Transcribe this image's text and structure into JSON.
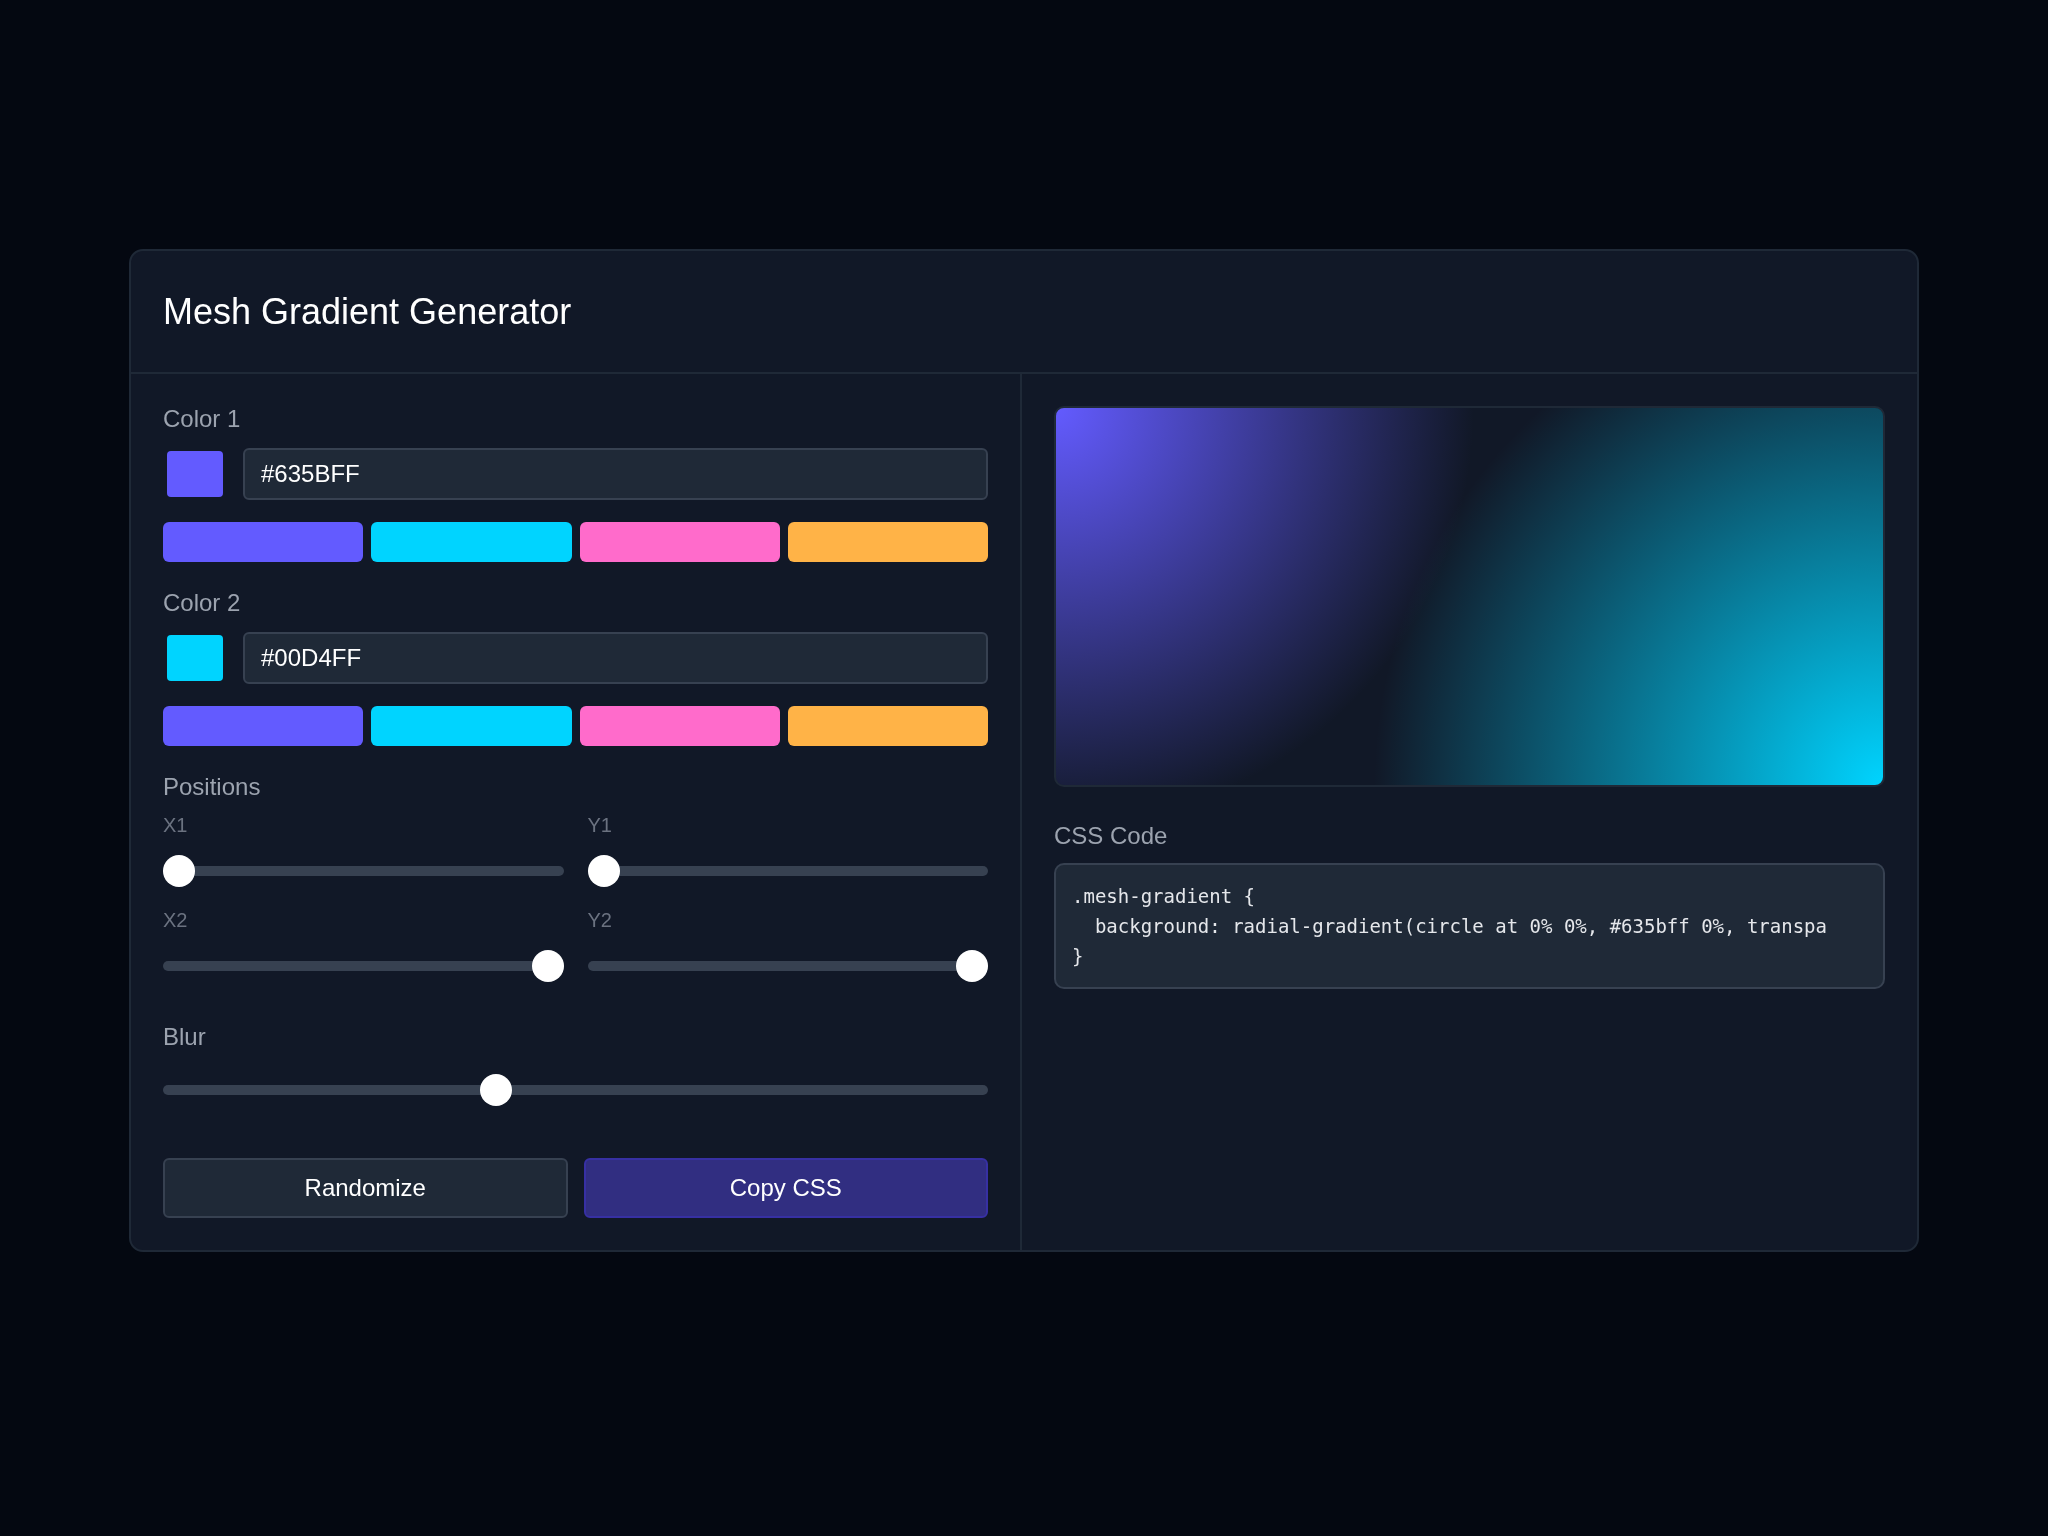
{
  "title": "Mesh Gradient Generator",
  "colors": [
    {
      "label": "Color 1",
      "color": "#635bff",
      "value": "#635BFF",
      "presets": [
        {
          "color": "#635bff"
        },
        {
          "color": "#00d4ff"
        },
        {
          "color": "#ff6bcb"
        },
        {
          "color": "#ffb347"
        }
      ]
    },
    {
      "label": "Color 2",
      "color": "#00d4ff",
      "value": "#00D4FF",
      "presets": [
        {
          "color": "#635bff"
        },
        {
          "color": "#00d4ff"
        },
        {
          "color": "#ff6bcb"
        },
        {
          "color": "#ffb347"
        }
      ]
    }
  ],
  "positions": {
    "label": "Positions",
    "sliders": [
      {
        "label": "X1",
        "level": 0
      },
      {
        "label": "Y1",
        "level": 0
      },
      {
        "label": "X2",
        "level": 1
      },
      {
        "label": "Y2",
        "level": 1
      }
    ]
  },
  "blur": {
    "label": "Blur",
    "level": 0.4
  },
  "buttons": [
    {
      "label": "Randomize",
      "kind": "secondary"
    },
    {
      "label": "Copy CSS",
      "kind": "primary"
    }
  ],
  "css_code": {
    "label": "CSS Code",
    "lines": [
      ".mesh-gradient {",
      "  background: radial-gradient(circle at 0% 0%, #635bff 0%, transpa",
      "}"
    ]
  }
}
